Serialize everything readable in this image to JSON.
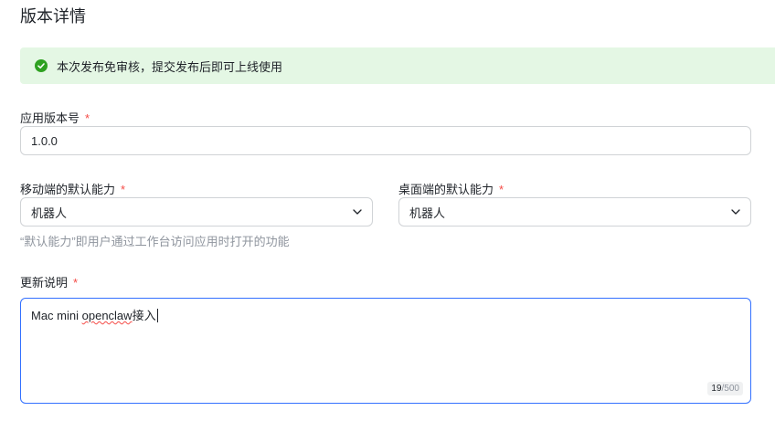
{
  "page": {
    "title": "版本详情"
  },
  "notice": {
    "text": "本次发布免审核，提交发布后即可上线使用",
    "icon": "check-circle-icon",
    "color": "#2ea121"
  },
  "version": {
    "label": "应用版本号",
    "required_mark": "*",
    "value": "1.0.0"
  },
  "mobile_default": {
    "label": "移动端的默认能力",
    "required_mark": "*",
    "selected": "机器人",
    "icon": "chevron-down-icon"
  },
  "desktop_default": {
    "label": "桌面端的默认能力",
    "required_mark": "*",
    "selected": "机器人",
    "icon": "chevron-down-icon"
  },
  "hint": "“默认能力”即用户通过工作台访问应用时打开的功能",
  "release_notes": {
    "label": "更新说明",
    "required_mark": "*",
    "value_prefix": "Mac mini ",
    "value_misspelled": "openclaw",
    "value_suffix": "接入",
    "count": "19",
    "max": "/500"
  },
  "colors": {
    "accent": "#3370ff",
    "required": "#f54a45",
    "success_bg": "#e4f7e4"
  }
}
